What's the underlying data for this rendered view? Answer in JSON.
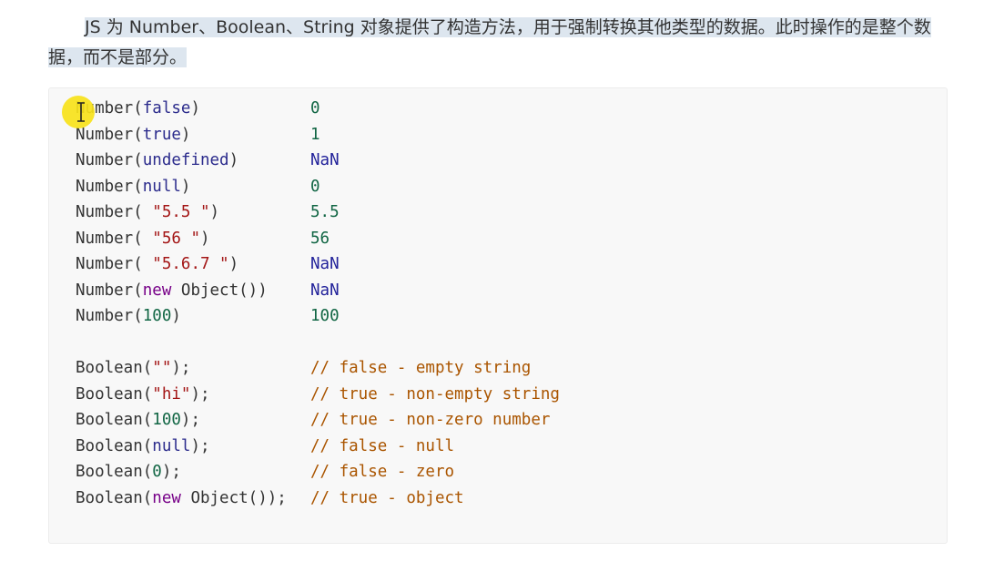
{
  "intro": {
    "text": "JS 为 Number、Boolean、String 对象提供了构造方法，用于强制转换其他类型的数据。此时操作的是整个数据，而不是部分。"
  },
  "code": {
    "lines": [
      {
        "fn": "Number(",
        "arg": "false",
        "arg_type": "kw",
        "close": ")",
        "result": "0",
        "result_type": "num"
      },
      {
        "fn": "Number(",
        "arg": "true",
        "arg_type": "kw",
        "close": ")",
        "result": "1",
        "result_type": "num"
      },
      {
        "fn": "Number(",
        "arg": "undefined",
        "arg_type": "kw",
        "close": ")",
        "result": "NaN",
        "result_type": "nan"
      },
      {
        "fn": "Number(",
        "arg": "null",
        "arg_type": "kw",
        "close": ")",
        "result": "0",
        "result_type": "num"
      },
      {
        "fn": "Number( ",
        "arg": "\"5.5 \"",
        "arg_type": "str",
        "close": ")",
        "result": "5.5",
        "result_type": "num"
      },
      {
        "fn": "Number( ",
        "arg": "\"56 \"",
        "arg_type": "str",
        "close": ")",
        "result": "56",
        "result_type": "num"
      },
      {
        "fn": "Number( ",
        "arg": "\"5.6.7 \"",
        "arg_type": "str",
        "close": ")",
        "result": "NaN",
        "result_type": "nan"
      },
      {
        "fn": "Number(",
        "arg": "new",
        "arg_type": "kw2",
        "rest": " Object()",
        "close": ")",
        "result": "NaN",
        "result_type": "nan"
      },
      {
        "fn": "Number(",
        "arg": "100",
        "arg_type": "num",
        "close": ")",
        "result": "100",
        "result_type": "num"
      },
      {
        "blank": true
      },
      {
        "fn": "Boolean(",
        "arg": "\"\"",
        "arg_type": "str",
        "close": ");",
        "result": "// false - empty string",
        "result_type": "cm"
      },
      {
        "fn": "Boolean(",
        "arg": "\"hi\"",
        "arg_type": "str",
        "close": ");",
        "result": "// true - non-empty string",
        "result_type": "cm"
      },
      {
        "fn": "Boolean(",
        "arg": "100",
        "arg_type": "num",
        "close": ");",
        "result": "// true - non-zero number",
        "result_type": "cm"
      },
      {
        "fn": "Boolean(",
        "arg": "null",
        "arg_type": "kw",
        "close": ");",
        "result": "// false - null",
        "result_type": "cm"
      },
      {
        "fn": "Boolean(",
        "arg": "0",
        "arg_type": "num",
        "close": ");",
        "result": "// false - zero",
        "result_type": "cm"
      },
      {
        "fn": "Boolean(",
        "arg": "new",
        "arg_type": "kw2",
        "rest": " Object()",
        "close": ");",
        "result": "// true - object",
        "result_type": "cm"
      }
    ]
  },
  "colors": {
    "background": "#ffffff",
    "code_background": "#f8f8f8",
    "selection": "#dde6ef",
    "cursor_highlight": "#f7e21a",
    "comment": "#aa5500",
    "string": "#a31515",
    "number": "#116644",
    "keyword": "#2b2b8c"
  },
  "icons": {
    "cursor": "text-cursor-icon"
  }
}
